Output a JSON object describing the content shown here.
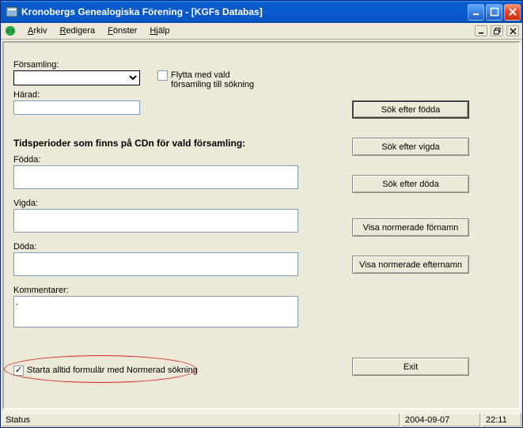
{
  "title": "Kronobergs Genealogiska Förening - [KGFs Databas]",
  "menu": {
    "arkiv": "Arkiv",
    "redigera": "Redigera",
    "fonster": "Fönster",
    "hjalp": "Hjälp"
  },
  "labels": {
    "forsamling": "Församling:",
    "harad": "Härad:",
    "flytta": "Flytta med vald församling till sökning",
    "section": "Tidsperioder som finns på CDn för vald församling:",
    "fodda": "Födda:",
    "vigda": "Vigda:",
    "doda": "Döda:",
    "kommentarer": "Kommentarer:",
    "starta": "Starta alltid formulär med Normerad sökning"
  },
  "buttons": {
    "sok_fodda": "Sök efter födda",
    "sok_vigda": "Sök efter vigda",
    "sok_doda": "Sök efter döda",
    "visa_fornamn": "Visa normerade förnamn",
    "visa_efternamn": "Visa normerade efternamn",
    "exit": "Exit"
  },
  "values": {
    "forsamling": "",
    "harad": "",
    "fodda": "",
    "vigda": "",
    "doda": "",
    "kommentarer": "."
  },
  "checks": {
    "flytta": false,
    "starta": true
  },
  "status": {
    "label": "Status",
    "date": "2004-09-07",
    "time": "22:11"
  }
}
